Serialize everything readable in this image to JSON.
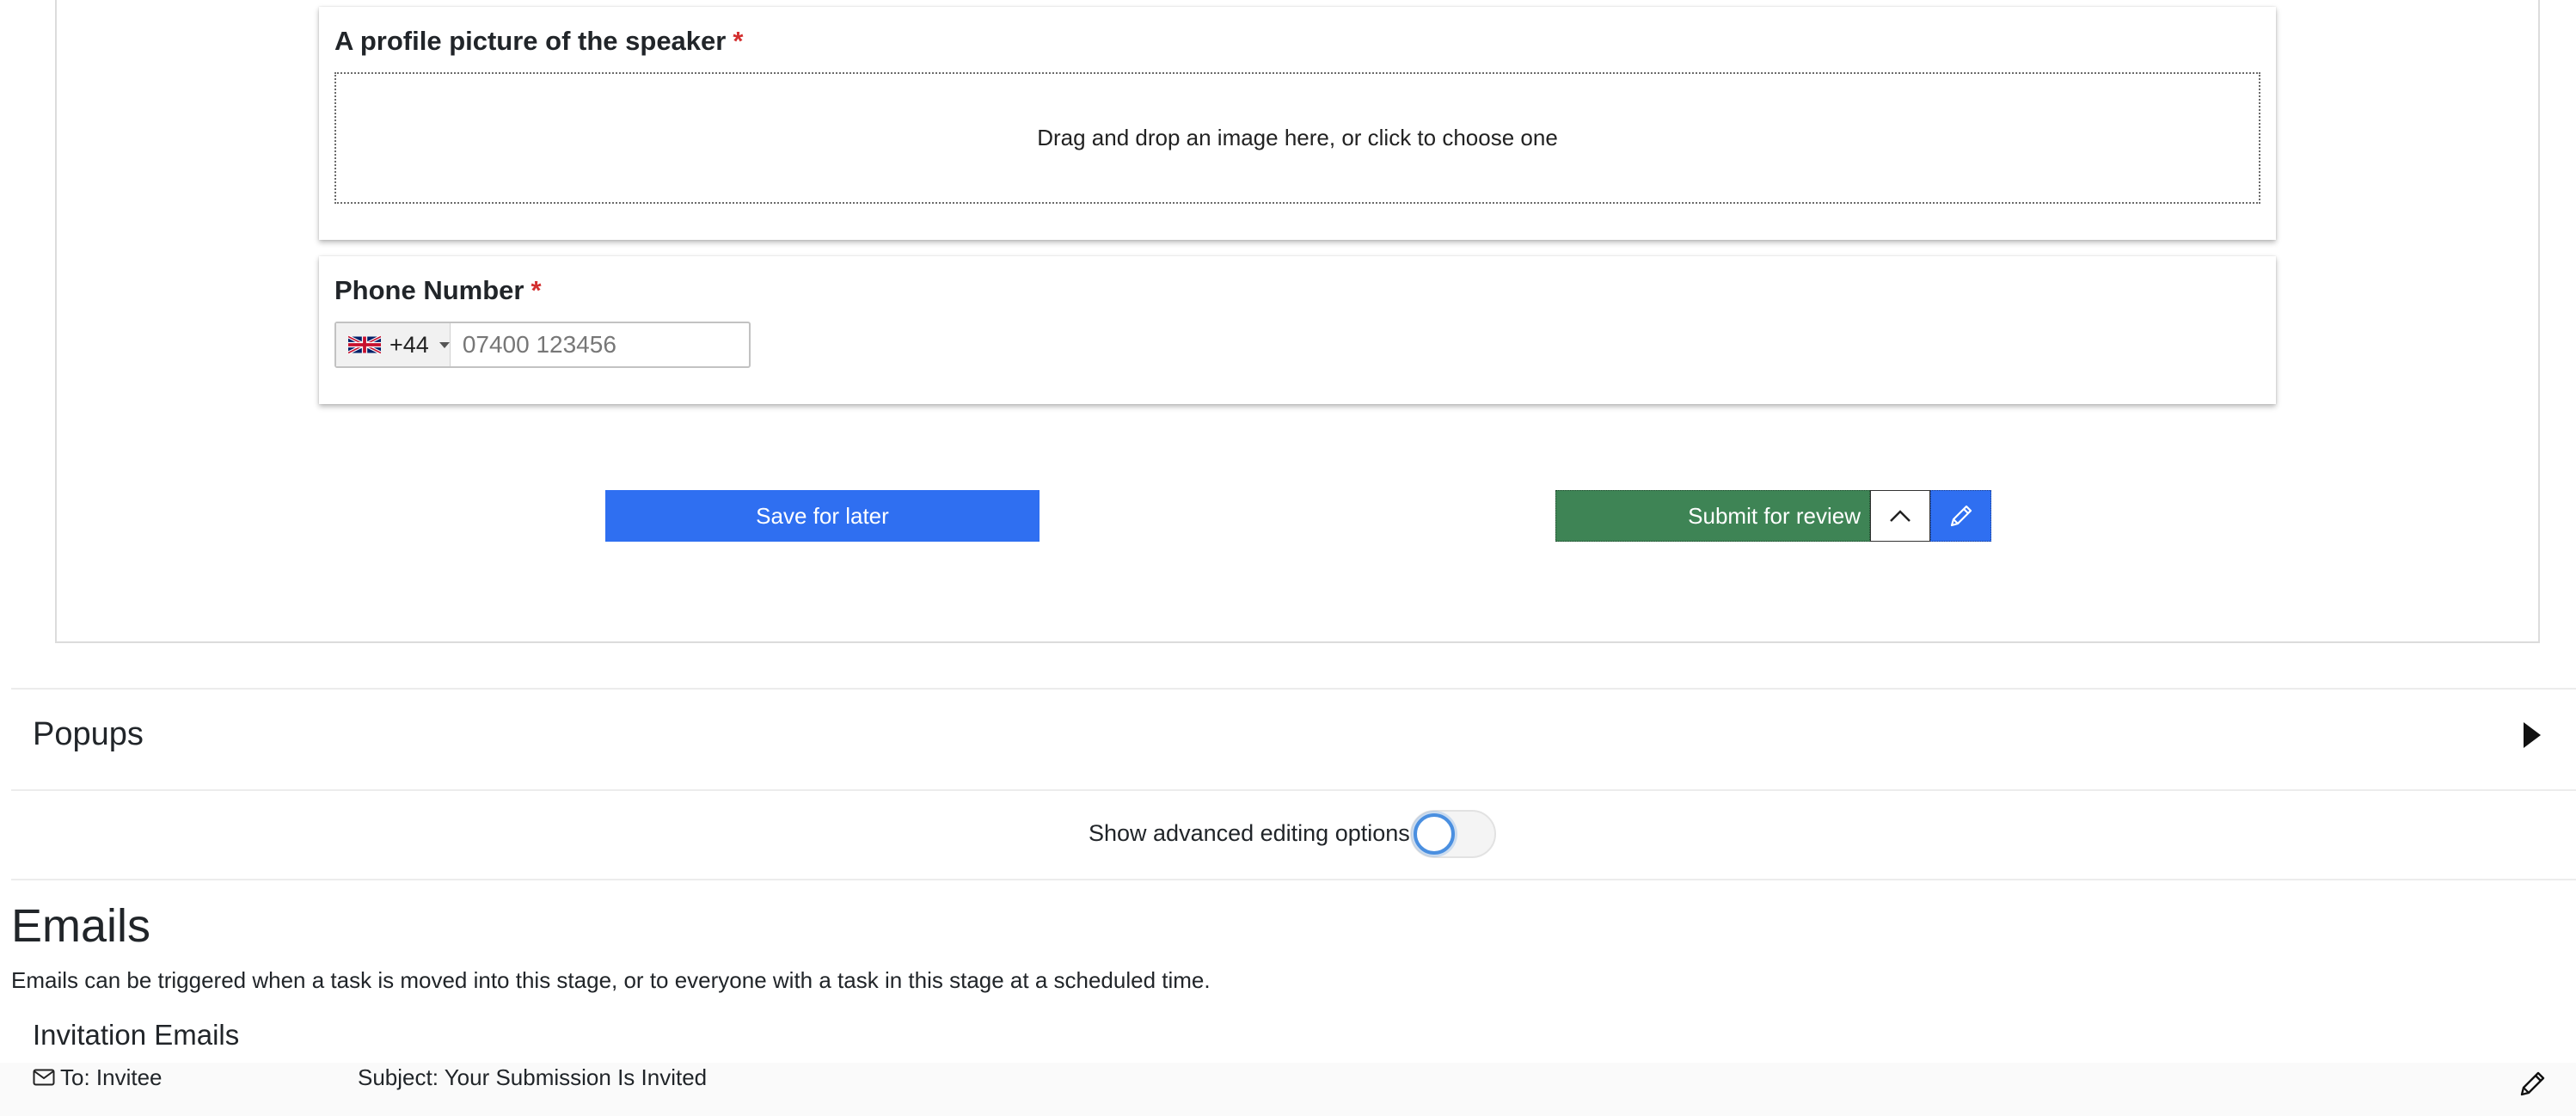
{
  "form": {
    "profile_picture": {
      "label": "A profile picture of the speaker",
      "required_mark": "*",
      "dropzone_text": "Drag and drop an image here, or click to choose one"
    },
    "phone": {
      "label": "Phone Number",
      "required_mark": "*",
      "country_flag": "uk-flag-icon",
      "dial_code": "+44",
      "placeholder": "07400 123456",
      "value": ""
    },
    "buttons": {
      "save_label": "Save for later",
      "submit_label": "Submit for review",
      "chevron_icon": "chevron-up-icon",
      "edit_icon": "pencil-icon"
    }
  },
  "popups": {
    "title": "Popups",
    "toggle_icon": "caret-right-icon"
  },
  "advanced_options": {
    "label": "Show advanced editing options",
    "enabled": false
  },
  "emails": {
    "title": "Emails",
    "description": "Emails can be triggered when a task is moved into this stage, or to everyone with a task in this stage at a scheduled time.",
    "invitation": {
      "title": "Invitation Emails",
      "to": "To: Invitee",
      "subject": "Subject: Your Submission Is Invited",
      "envelope_icon": "envelope-icon",
      "edit_icon": "pencil-icon"
    }
  },
  "colors": {
    "primary_blue": "#2f6ff1",
    "submit_green": "#3e8455",
    "required_red": "#d32f2f",
    "switch_ring": "#4a8fe0"
  }
}
